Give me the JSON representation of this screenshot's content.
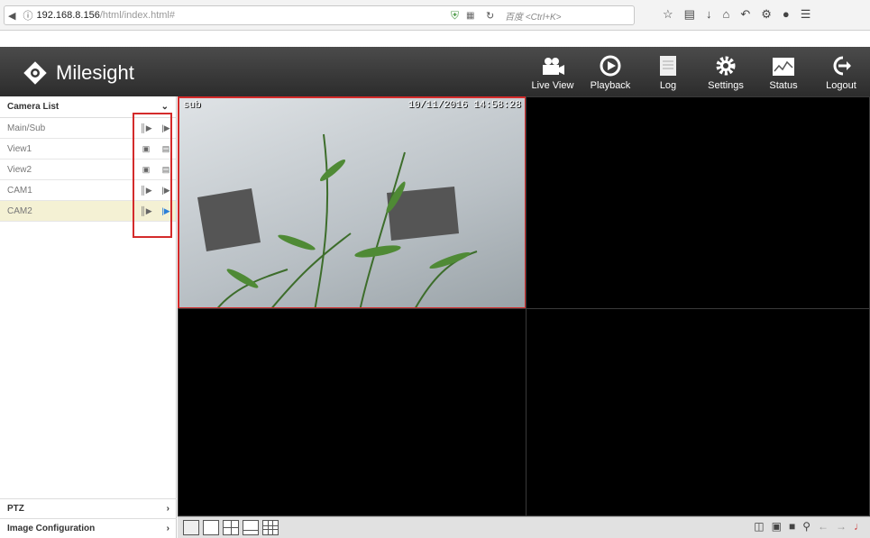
{
  "browser": {
    "url_host": "192.168.8.156",
    "url_path": "/html/index.html#",
    "search_placeholder": "百度 <Ctrl+K>"
  },
  "brand": "Milesight",
  "nav": [
    {
      "label": "Live View",
      "icon": "camera-icon"
    },
    {
      "label": "Playback",
      "icon": "playback-icon"
    },
    {
      "label": "Log",
      "icon": "document-icon"
    },
    {
      "label": "Settings",
      "icon": "gear-icon"
    },
    {
      "label": "Status",
      "icon": "graph-icon"
    },
    {
      "label": "Logout",
      "icon": "logout-icon"
    }
  ],
  "sidebar": {
    "title": "Camera List",
    "items": [
      {
        "label": "Main/Sub"
      },
      {
        "label": "View1"
      },
      {
        "label": "View2"
      },
      {
        "label": "CAM1"
      },
      {
        "label": "CAM2"
      }
    ],
    "footer": [
      {
        "label": "PTZ"
      },
      {
        "label": "Image Configuration"
      }
    ]
  },
  "video": {
    "osd_stream": "sub",
    "osd_time": "10/11/2016 14:58:28"
  },
  "colors": {
    "accent": "#d42b2b",
    "header_bg": "#3a3a3a",
    "selected_row": "#f4f1d4"
  }
}
